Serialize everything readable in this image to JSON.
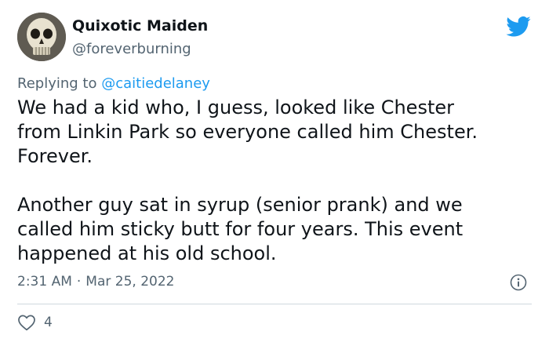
{
  "author": {
    "display_name": "Quixotic Maiden",
    "handle": "@foreverburning"
  },
  "reply": {
    "prefix": "Replying to ",
    "mention": "@caitiedelaney"
  },
  "tweet": {
    "lines_para1": [
      "We had a kid who, I guess, looked like Chester",
      "from Linkin Park so everyone called him Chester.",
      "Forever."
    ],
    "lines_para2": [
      "Another guy sat in syrup (senior prank) and we",
      "called him sticky butt for four years. This event",
      "happened at his old school."
    ]
  },
  "meta": {
    "time": "2:31 AM",
    "separator": "·",
    "date": "Mar 25, 2022"
  },
  "actions": {
    "like_count": "4"
  },
  "icons": {
    "brand": "twitter-bird-icon",
    "info": "info-icon",
    "like": "heart-icon"
  },
  "colors": {
    "accent": "#1d9bf0",
    "text": "#0f1419",
    "secondary": "#536471",
    "divider": "#cfd9de"
  }
}
